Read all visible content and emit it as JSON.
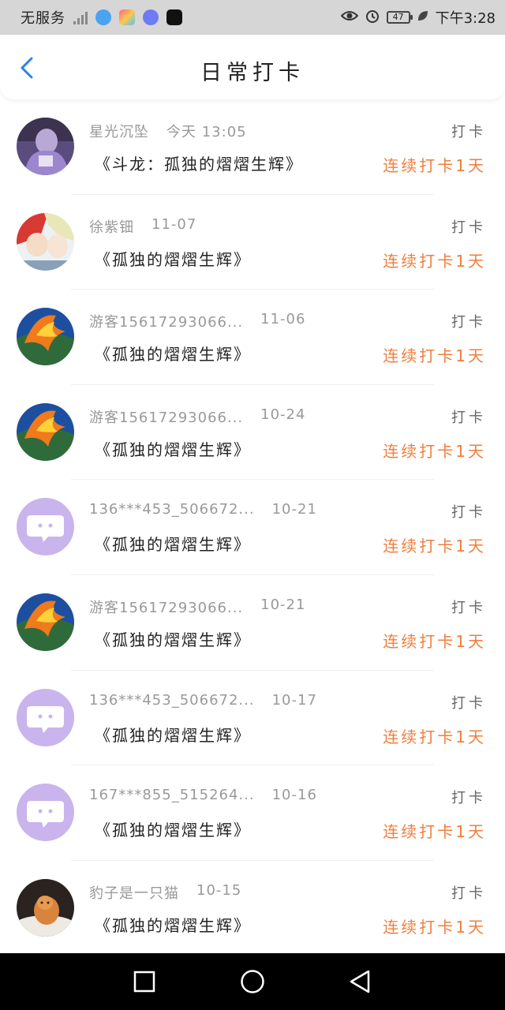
{
  "status_bar": {
    "carrier": "无服务",
    "battery": "47",
    "time": "下午3:28"
  },
  "header": {
    "title": "日常打卡",
    "back_icon": "chevron-left-icon"
  },
  "colors": {
    "accent": "#2b82e6",
    "streak": "#f07e3c",
    "avatar_purple": "#c9b4ee"
  },
  "records": [
    {
      "name": "星光沉坠",
      "date": "今天 13:05",
      "book": "《斗龙：孤独的熠熠生辉》",
      "action": "打卡",
      "streak": "连续打卡1天",
      "avatar": "photo-purple"
    },
    {
      "name": "徐紫钿",
      "date": "11-07",
      "book": "《孤独的熠熠生辉》",
      "action": "打卡",
      "streak": "连续打卡1天",
      "avatar": "anime"
    },
    {
      "name": "游客15617293066...",
      "date": "11-06",
      "book": "《孤独的熠熠生辉》",
      "action": "打卡",
      "streak": "连续打卡1天",
      "avatar": "phoenix"
    },
    {
      "name": "游客15617293066...",
      "date": "10-24",
      "book": "《孤独的熠熠生辉》",
      "action": "打卡",
      "streak": "连续打卡1天",
      "avatar": "phoenix"
    },
    {
      "name": "136***453_506672...",
      "date": "10-21",
      "book": "《孤独的熠熠生辉》",
      "action": "打卡",
      "streak": "连续打卡1天",
      "avatar": "chat"
    },
    {
      "name": "游客15617293066...",
      "date": "10-21",
      "book": "《孤独的熠熠生辉》",
      "action": "打卡",
      "streak": "连续打卡1天",
      "avatar": "phoenix"
    },
    {
      "name": "136***453_506672...",
      "date": "10-17",
      "book": "《孤独的熠熠生辉》",
      "action": "打卡",
      "streak": "连续打卡1天",
      "avatar": "chat"
    },
    {
      "name": "167***855_515264...",
      "date": "10-16",
      "book": "《孤独的熠熠生辉》",
      "action": "打卡",
      "streak": "连续打卡1天",
      "avatar": "chat"
    },
    {
      "name": "豹子是一只猫",
      "date": "10-15",
      "book": "《孤独的熠熠生辉》",
      "action": "打卡",
      "streak": "连续打卡1天",
      "avatar": "cat"
    }
  ],
  "nav_bar": {
    "icons": [
      "square-recents-icon",
      "circle-home-icon",
      "triangle-back-icon"
    ]
  }
}
